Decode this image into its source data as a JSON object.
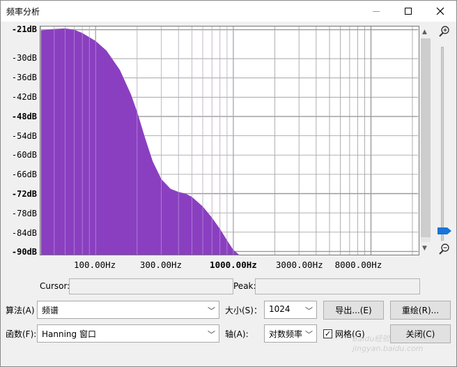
{
  "window": {
    "title": "频率分析"
  },
  "colors": {
    "fill": "#8a3fc0",
    "grid": "#9a9a9a",
    "plot_bg": "#ffffff",
    "zoom_thumb": "#1a73d9"
  },
  "chart_data": {
    "type": "area",
    "title": "",
    "xlabel": "",
    "ylabel": "",
    "x_scale": "log",
    "xlim": [
      40,
      22050
    ],
    "ylim": [
      -91,
      -20
    ],
    "grid": true,
    "y_ticks": [
      "-21dB",
      "-30dB",
      "-36dB",
      "-42dB",
      "-48dB",
      "-54dB",
      "-60dB",
      "-66dB",
      "-72dB",
      "-78dB",
      "-84dB",
      "-90dB"
    ],
    "y_tick_values": [
      -21,
      -30,
      -36,
      -42,
      -48,
      -54,
      -60,
      -66,
      -72,
      -78,
      -84,
      -90
    ],
    "y_bold": [
      -21,
      -48,
      -72,
      -90
    ],
    "x_ticks": [
      "100.00Hz",
      "300.00Hz",
      "1000.00Hz",
      "3000.00Hz",
      "8000.00Hz"
    ],
    "x_tick_values": [
      100,
      300,
      1000,
      3000,
      8000
    ],
    "x_bold": [
      1000
    ],
    "x": [
      40,
      50,
      60,
      70,
      80,
      100,
      120,
      150,
      180,
      200,
      230,
      260,
      300,
      350,
      400,
      450,
      500,
      600,
      700,
      800,
      900,
      1000,
      1100
    ],
    "y": [
      -21.2,
      -20.8,
      -20.6,
      -21.0,
      -22.0,
      -24.5,
      -27.5,
      -33.5,
      -41.0,
      -46.5,
      -55.0,
      -62.0,
      -67.5,
      -70.5,
      -71.5,
      -72.0,
      -73.0,
      -76.0,
      -79.5,
      -83.0,
      -86.5,
      -89.5,
      -91.0
    ]
  },
  "cursor": {
    "label": "Cursor:",
    "value": ""
  },
  "peak": {
    "label": "Peak:",
    "value": ""
  },
  "controls": {
    "algorithm_label": "算法(A)",
    "algorithm_value": "频谱",
    "size_label": "大小(S)：",
    "size_value": "1024",
    "export_label": "导出...(E)",
    "redraw_label": "重绘(R)...",
    "function_label": "函数(F):",
    "function_value": "Hanning 窗口",
    "axis_label": "轴(A):",
    "axis_value": "对数频率",
    "grid_label": "网格(G)",
    "grid_checked": true,
    "close_label": "关闭(C)"
  },
  "watermark": "Baidu经验 jingyan.baidu.com"
}
